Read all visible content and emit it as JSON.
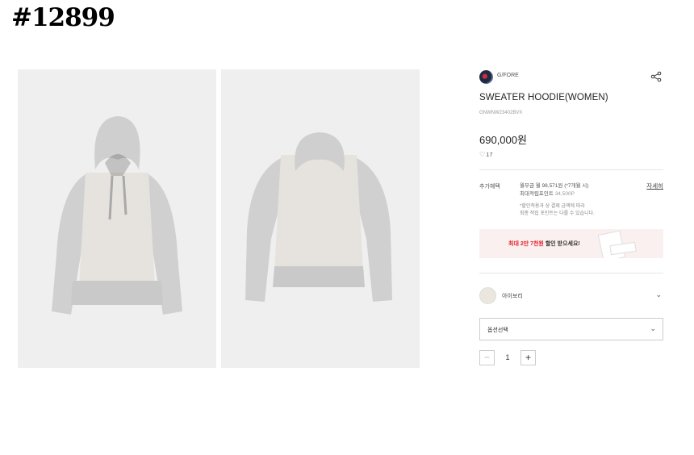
{
  "watermark": "#12899",
  "gallery": {
    "images": [
      {
        "name": "front-view",
        "description": "gray sweater hoodie front"
      },
      {
        "name": "back-view",
        "description": "gray sweater hoodie back"
      }
    ]
  },
  "product": {
    "brand": "G/FORE",
    "name": "SWEATER HOODIE(WOMEN)",
    "code": "GNWNW23402BVX",
    "price": "690,000원",
    "likes": "17"
  },
  "benefits": {
    "label": "추가혜택",
    "installment": "월부금 월 98,571원 (*7개월 시)",
    "points_label": "최대적립포인트",
    "points_value": "34,500P",
    "note_line1": "*할인적용과 상 결제 금액에 따라",
    "note_line2": "최종 적립 포인트는 다를 수 있습니다.",
    "detail_link": "자세히"
  },
  "coupon": {
    "highlight": "최대 2만 7천원",
    "text": " 할인 받으세요!"
  },
  "color_option": {
    "name": "아이보리",
    "swatch": "#ebe7df"
  },
  "option_select": {
    "label": "옵션선택"
  },
  "quantity": {
    "minus": "−",
    "value": "1",
    "plus": "+"
  },
  "colors": {
    "accent_red": "#e0262f",
    "coupon_bg": "#fbf0f0",
    "photo_bg": "#efefef"
  }
}
